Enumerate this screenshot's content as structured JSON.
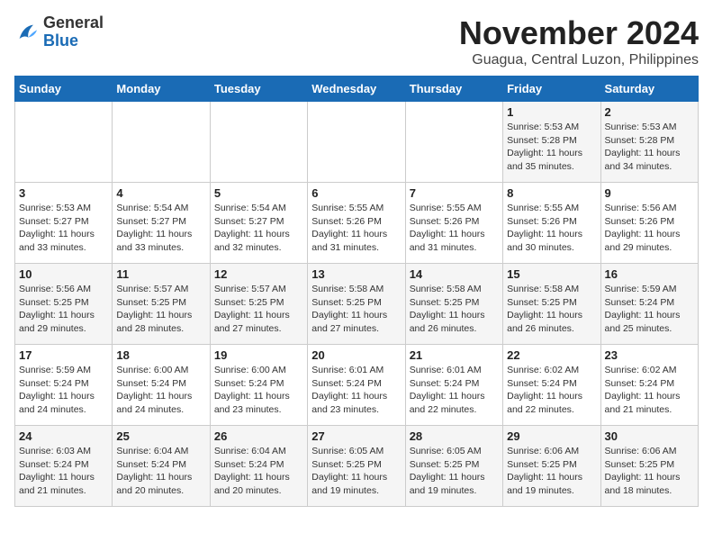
{
  "logo": {
    "general": "General",
    "blue": "Blue"
  },
  "title": "November 2024",
  "subtitle": "Guagua, Central Luzon, Philippines",
  "days_of_week": [
    "Sunday",
    "Monday",
    "Tuesday",
    "Wednesday",
    "Thursday",
    "Friday",
    "Saturday"
  ],
  "weeks": [
    [
      {
        "day": "",
        "info": ""
      },
      {
        "day": "",
        "info": ""
      },
      {
        "day": "",
        "info": ""
      },
      {
        "day": "",
        "info": ""
      },
      {
        "day": "",
        "info": ""
      },
      {
        "day": "1",
        "info": "Sunrise: 5:53 AM\nSunset: 5:28 PM\nDaylight: 11 hours and 35 minutes."
      },
      {
        "day": "2",
        "info": "Sunrise: 5:53 AM\nSunset: 5:28 PM\nDaylight: 11 hours and 34 minutes."
      }
    ],
    [
      {
        "day": "3",
        "info": "Sunrise: 5:53 AM\nSunset: 5:27 PM\nDaylight: 11 hours and 33 minutes."
      },
      {
        "day": "4",
        "info": "Sunrise: 5:54 AM\nSunset: 5:27 PM\nDaylight: 11 hours and 33 minutes."
      },
      {
        "day": "5",
        "info": "Sunrise: 5:54 AM\nSunset: 5:27 PM\nDaylight: 11 hours and 32 minutes."
      },
      {
        "day": "6",
        "info": "Sunrise: 5:55 AM\nSunset: 5:26 PM\nDaylight: 11 hours and 31 minutes."
      },
      {
        "day": "7",
        "info": "Sunrise: 5:55 AM\nSunset: 5:26 PM\nDaylight: 11 hours and 31 minutes."
      },
      {
        "day": "8",
        "info": "Sunrise: 5:55 AM\nSunset: 5:26 PM\nDaylight: 11 hours and 30 minutes."
      },
      {
        "day": "9",
        "info": "Sunrise: 5:56 AM\nSunset: 5:26 PM\nDaylight: 11 hours and 29 minutes."
      }
    ],
    [
      {
        "day": "10",
        "info": "Sunrise: 5:56 AM\nSunset: 5:25 PM\nDaylight: 11 hours and 29 minutes."
      },
      {
        "day": "11",
        "info": "Sunrise: 5:57 AM\nSunset: 5:25 PM\nDaylight: 11 hours and 28 minutes."
      },
      {
        "day": "12",
        "info": "Sunrise: 5:57 AM\nSunset: 5:25 PM\nDaylight: 11 hours and 27 minutes."
      },
      {
        "day": "13",
        "info": "Sunrise: 5:58 AM\nSunset: 5:25 PM\nDaylight: 11 hours and 27 minutes."
      },
      {
        "day": "14",
        "info": "Sunrise: 5:58 AM\nSunset: 5:25 PM\nDaylight: 11 hours and 26 minutes."
      },
      {
        "day": "15",
        "info": "Sunrise: 5:58 AM\nSunset: 5:25 PM\nDaylight: 11 hours and 26 minutes."
      },
      {
        "day": "16",
        "info": "Sunrise: 5:59 AM\nSunset: 5:24 PM\nDaylight: 11 hours and 25 minutes."
      }
    ],
    [
      {
        "day": "17",
        "info": "Sunrise: 5:59 AM\nSunset: 5:24 PM\nDaylight: 11 hours and 24 minutes."
      },
      {
        "day": "18",
        "info": "Sunrise: 6:00 AM\nSunset: 5:24 PM\nDaylight: 11 hours and 24 minutes."
      },
      {
        "day": "19",
        "info": "Sunrise: 6:00 AM\nSunset: 5:24 PM\nDaylight: 11 hours and 23 minutes."
      },
      {
        "day": "20",
        "info": "Sunrise: 6:01 AM\nSunset: 5:24 PM\nDaylight: 11 hours and 23 minutes."
      },
      {
        "day": "21",
        "info": "Sunrise: 6:01 AM\nSunset: 5:24 PM\nDaylight: 11 hours and 22 minutes."
      },
      {
        "day": "22",
        "info": "Sunrise: 6:02 AM\nSunset: 5:24 PM\nDaylight: 11 hours and 22 minutes."
      },
      {
        "day": "23",
        "info": "Sunrise: 6:02 AM\nSunset: 5:24 PM\nDaylight: 11 hours and 21 minutes."
      }
    ],
    [
      {
        "day": "24",
        "info": "Sunrise: 6:03 AM\nSunset: 5:24 PM\nDaylight: 11 hours and 21 minutes."
      },
      {
        "day": "25",
        "info": "Sunrise: 6:04 AM\nSunset: 5:24 PM\nDaylight: 11 hours and 20 minutes."
      },
      {
        "day": "26",
        "info": "Sunrise: 6:04 AM\nSunset: 5:24 PM\nDaylight: 11 hours and 20 minutes."
      },
      {
        "day": "27",
        "info": "Sunrise: 6:05 AM\nSunset: 5:25 PM\nDaylight: 11 hours and 19 minutes."
      },
      {
        "day": "28",
        "info": "Sunrise: 6:05 AM\nSunset: 5:25 PM\nDaylight: 11 hours and 19 minutes."
      },
      {
        "day": "29",
        "info": "Sunrise: 6:06 AM\nSunset: 5:25 PM\nDaylight: 11 hours and 19 minutes."
      },
      {
        "day": "30",
        "info": "Sunrise: 6:06 AM\nSunset: 5:25 PM\nDaylight: 11 hours and 18 minutes."
      }
    ]
  ]
}
